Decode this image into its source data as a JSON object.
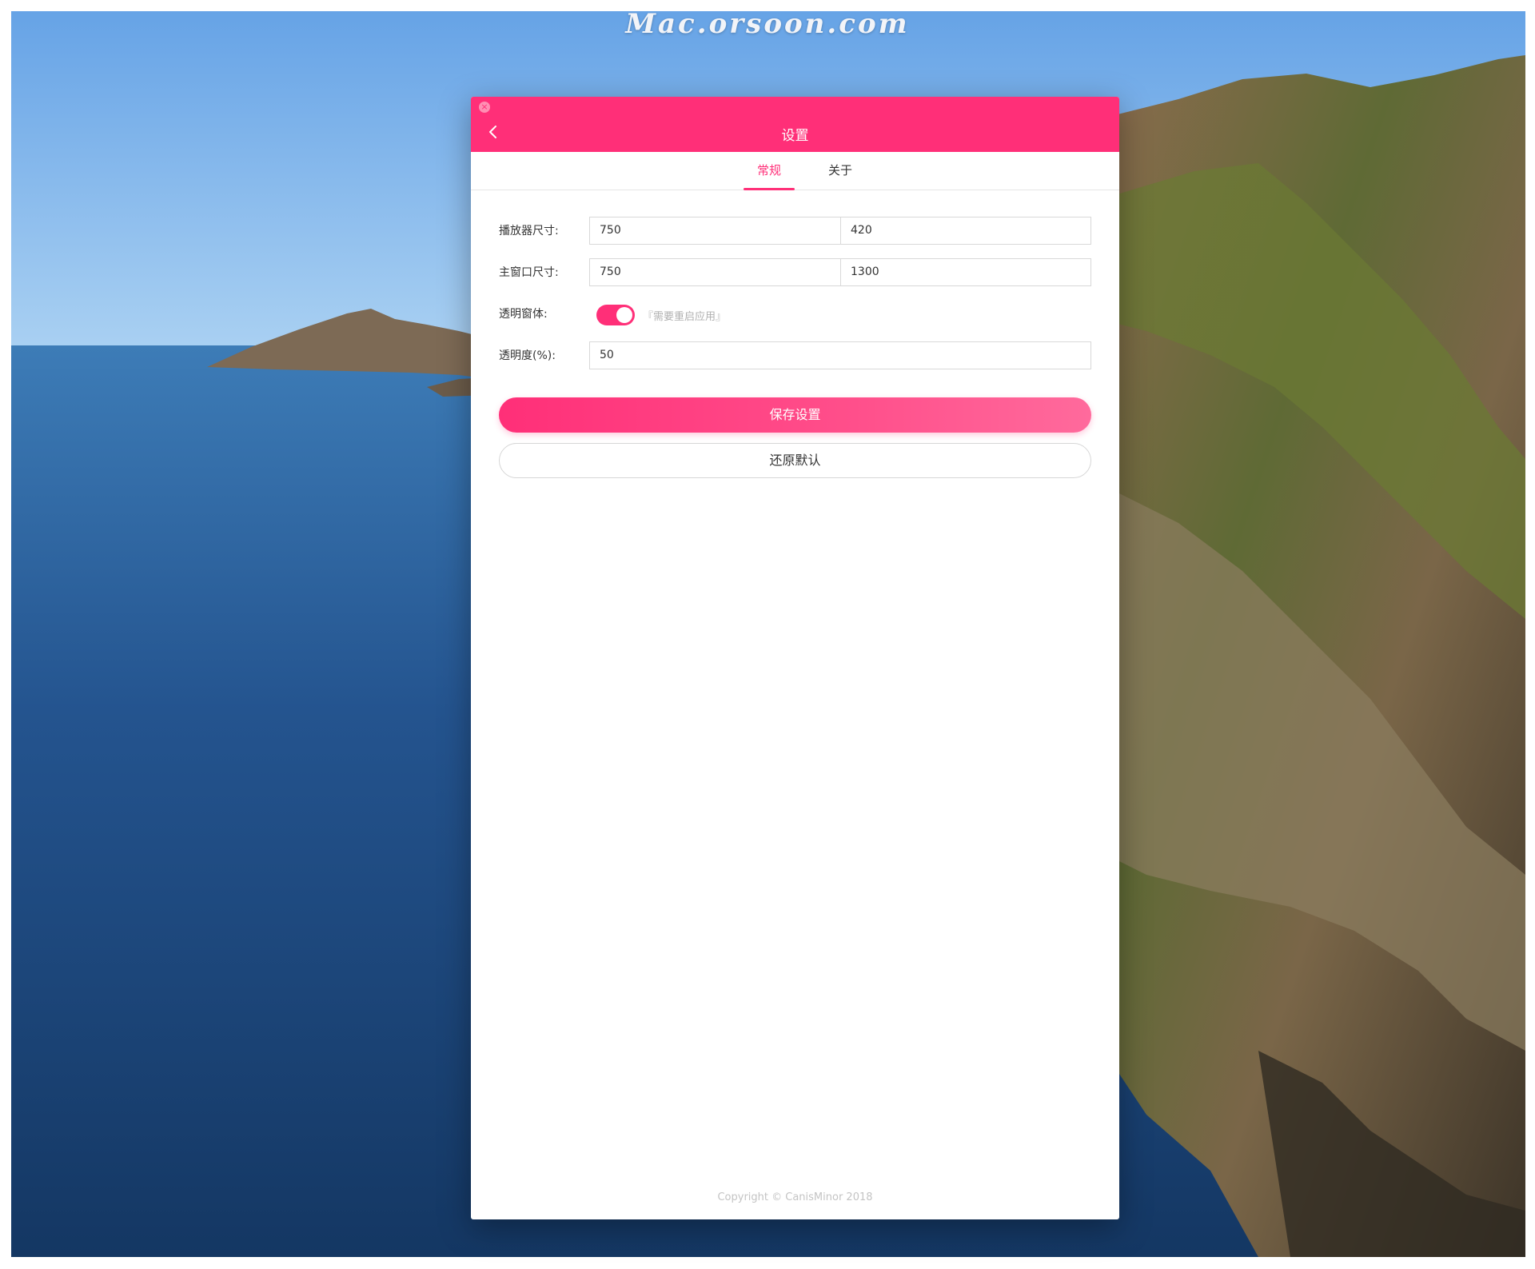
{
  "watermark": "Mac.orsoon.com",
  "window": {
    "title": "设置",
    "accent_color": "#ff2f78",
    "close_icon": "close-icon",
    "back_icon": "chevron-left-icon"
  },
  "tabs": [
    {
      "label": "常规",
      "active": true
    },
    {
      "label": "关于",
      "active": false
    }
  ],
  "form": {
    "player_size": {
      "label": "播放器尺寸:",
      "width": "750",
      "height": "420"
    },
    "main_window_size": {
      "label": "主窗口尺寸:",
      "width": "750",
      "height": "1300"
    },
    "transparent_window": {
      "label": "透明窗体:",
      "enabled": true,
      "hint": "『需要重启应用』"
    },
    "opacity": {
      "label": "透明度(%):",
      "value": "50"
    }
  },
  "buttons": {
    "save": "保存设置",
    "reset": "还原默认"
  },
  "footer": {
    "copyright": "Copyright ©  CanisMinor 2018"
  }
}
